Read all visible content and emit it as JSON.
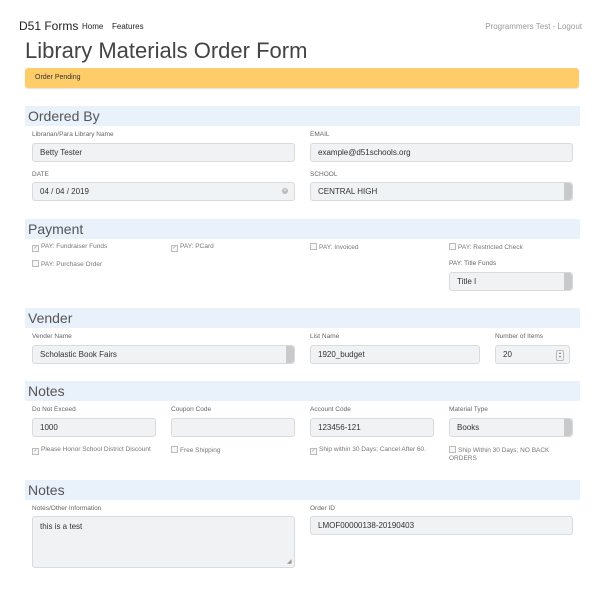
{
  "header": {
    "brand": "D51 Forms",
    "nav": [
      "Home",
      "Features"
    ],
    "user_links": "Programmers Test - Logout"
  },
  "page_title": "Library Materials Order Form",
  "alert": "Order Pending",
  "ordered_by": {
    "heading": "Ordered By",
    "name_label": "Librarian/Para Library Name",
    "name_value": "Betty Tester",
    "email_label": "EMAIL",
    "email_value": "example@d51schools.org",
    "date_label": "DATE",
    "date_value": "04 / 04 / 2019",
    "school_label": "SCHOOL",
    "school_value": "CENTRAL HIGH"
  },
  "payment": {
    "heading": "Payment",
    "options": [
      {
        "label": "PAY: Fundraiser Funds",
        "checked": true
      },
      {
        "label": "PAY: PCard",
        "checked": true
      },
      {
        "label": "PAY: Invoiced",
        "checked": false
      },
      {
        "label": "PAY: Restricted Check",
        "checked": false
      },
      {
        "label": "PAY: Purchase Order",
        "checked": false
      }
    ],
    "title_funds_label": "PAY: Title Funds",
    "title_funds_value": "Title I"
  },
  "vender": {
    "heading": "Vender",
    "name_label": "Vender Name",
    "name_value": "Scholastic Book Fairs",
    "list_label": "List Name",
    "list_value": "1920_budget",
    "items_label": "Number of Items",
    "items_value": "20"
  },
  "notes1": {
    "heading": "Notes",
    "dne_label": "Do Not Exceed",
    "dne_value": "1000",
    "coupon_label": "Coupon Code",
    "coupon_value": "",
    "account_label": "Account Code",
    "account_value": "123456-121",
    "material_label": "Material Type",
    "material_value": "Books",
    "checks": [
      {
        "label": "Please Honor School District Discount",
        "checked": true
      },
      {
        "label": "Free Shipping",
        "checked": false
      },
      {
        "label": "Ship within 30 Days; Cancel After 60.",
        "checked": true
      },
      {
        "label": "Ship Within 30 Days; NO BACK ORDERS",
        "checked": false
      }
    ]
  },
  "notes2": {
    "heading": "Notes",
    "other_label": "Notes/Other Information",
    "other_value": "this is a test",
    "order_id_label": "Order ID",
    "order_id_value": "LMOF00000138-20190403"
  }
}
